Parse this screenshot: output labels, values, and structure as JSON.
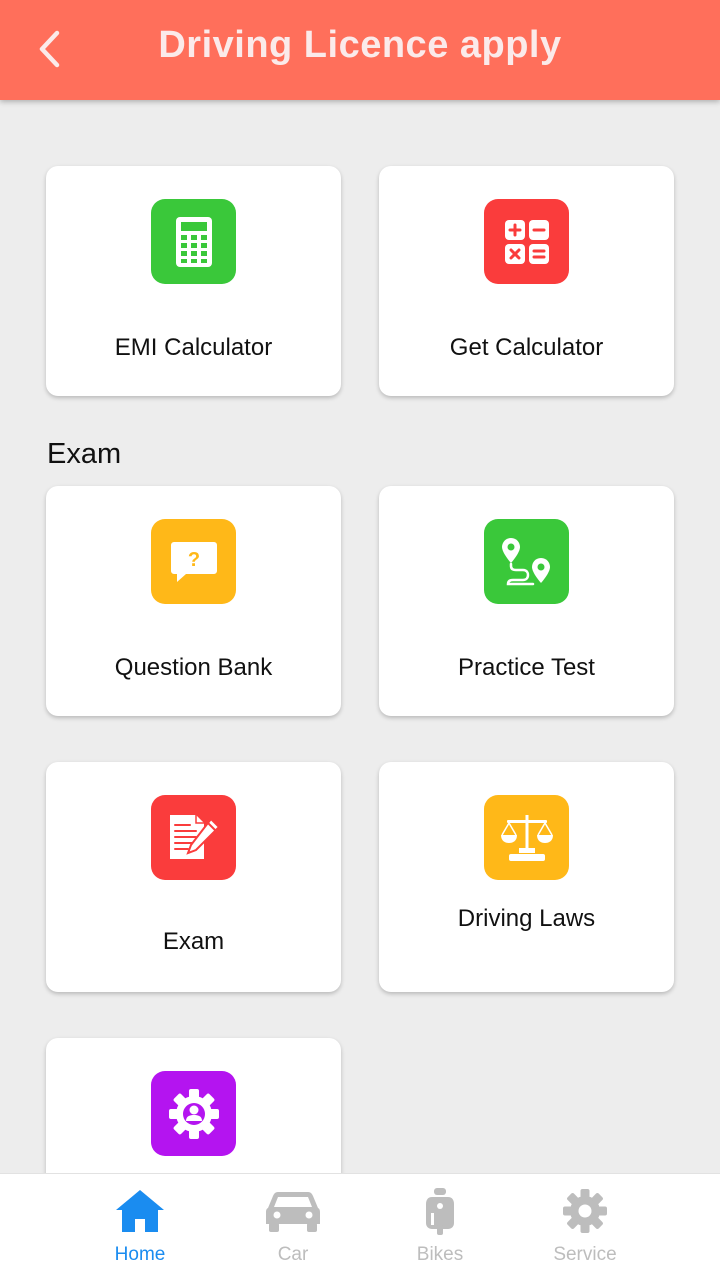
{
  "header": {
    "title": "Driving Licence apply",
    "back_icon": "chevron-left-icon",
    "background": "#ff6f5b"
  },
  "cards_top": [
    {
      "label": "EMI Calculator",
      "icon": "calculator-icon",
      "color": "#3ac83a"
    },
    {
      "label": "Get Calculator",
      "icon": "math-operators-icon",
      "color": "#fa3c3c"
    }
  ],
  "exam_section": {
    "title": "Exam",
    "cards": [
      {
        "label": "Question Bank",
        "icon": "question-bubble-icon",
        "color": "#ffb818"
      },
      {
        "label": "Practice Test",
        "icon": "route-pins-icon",
        "color": "#3ac83a"
      },
      {
        "label": "Exam",
        "icon": "document-pencil-icon",
        "color": "#fa3c3c"
      },
      {
        "label": "Driving Laws",
        "icon": "scales-icon",
        "color": "#ffb818"
      },
      {
        "label": "",
        "icon": "gear-user-icon",
        "color": "#b414f0"
      }
    ]
  },
  "bottom_nav": {
    "items": [
      {
        "label": "Home",
        "icon": "home-icon",
        "active": true
      },
      {
        "label": "Car",
        "icon": "car-icon",
        "active": false
      },
      {
        "label": "Bikes",
        "icon": "scooter-icon",
        "active": false
      },
      {
        "label": "Service",
        "icon": "gear-icon",
        "active": false
      }
    ],
    "active_color": "#1a8cf0",
    "inactive_color": "#bdbdbd"
  }
}
